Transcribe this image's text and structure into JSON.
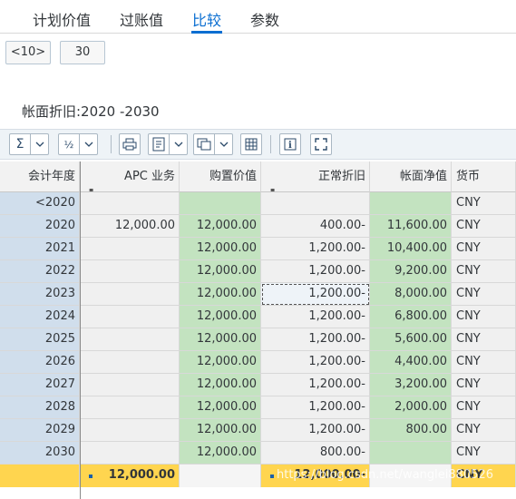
{
  "tabs": [
    {
      "label": "计划价值"
    },
    {
      "label": "过账值"
    },
    {
      "label": "比较"
    },
    {
      "label": "参数"
    }
  ],
  "buttons": {
    "prev": "<10>",
    "next": "30"
  },
  "heading": "帐面折旧:2020 -2030",
  "toolbar": {
    "icons": [
      "sum-icon",
      "subtotal-icon",
      "print-icon",
      "export-icon",
      "layout-icon",
      "grid-icon",
      "info-icon",
      "fullscreen-icon"
    ]
  },
  "columns": [
    "会计年度",
    "APC 业务",
    "购置价值",
    "正常折旧",
    "帐面净值",
    "货币"
  ],
  "rows": [
    {
      "year": "<2020",
      "apc": "",
      "acq": "",
      "dep": "",
      "net": "",
      "cur": "CNY"
    },
    {
      "year": "2020",
      "apc": "12,000.00",
      "acq": "12,000.00",
      "dep": "400.00-",
      "net": "11,600.00",
      "cur": "CNY"
    },
    {
      "year": "2021",
      "apc": "",
      "acq": "12,000.00",
      "dep": "1,200.00-",
      "net": "10,400.00",
      "cur": "CNY"
    },
    {
      "year": "2022",
      "apc": "",
      "acq": "12,000.00",
      "dep": "1,200.00-",
      "net": "9,200.00",
      "cur": "CNY"
    },
    {
      "year": "2023",
      "apc": "",
      "acq": "12,000.00",
      "dep": "1,200.00-",
      "net": "8,000.00",
      "cur": "CNY"
    },
    {
      "year": "2024",
      "apc": "",
      "acq": "12,000.00",
      "dep": "1,200.00-",
      "net": "6,800.00",
      "cur": "CNY"
    },
    {
      "year": "2025",
      "apc": "",
      "acq": "12,000.00",
      "dep": "1,200.00-",
      "net": "5,600.00",
      "cur": "CNY"
    },
    {
      "year": "2026",
      "apc": "",
      "acq": "12,000.00",
      "dep": "1,200.00-",
      "net": "4,400.00",
      "cur": "CNY"
    },
    {
      "year": "2027",
      "apc": "",
      "acq": "12,000.00",
      "dep": "1,200.00-",
      "net": "3,200.00",
      "cur": "CNY"
    },
    {
      "year": "2028",
      "apc": "",
      "acq": "12,000.00",
      "dep": "1,200.00-",
      "net": "2,000.00",
      "cur": "CNY"
    },
    {
      "year": "2029",
      "apc": "",
      "acq": "12,000.00",
      "dep": "1,200.00-",
      "net": "800.00",
      "cur": "CNY"
    },
    {
      "year": "2030",
      "apc": "",
      "acq": "12,000.00",
      "dep": "800.00-",
      "net": "",
      "cur": "CNY"
    }
  ],
  "total": {
    "year": "",
    "apc": "12,000.00",
    "acq": "",
    "dep": "12,000.00-",
    "net": "",
    "cur": "CNY"
  },
  "watermark": "https://blog.csdn.net/wanglei880526",
  "colors": {
    "accent": "#0a6ed1",
    "key_col": "#d0deec",
    "green": "#c3e3c0",
    "total": "#ffd54f"
  }
}
